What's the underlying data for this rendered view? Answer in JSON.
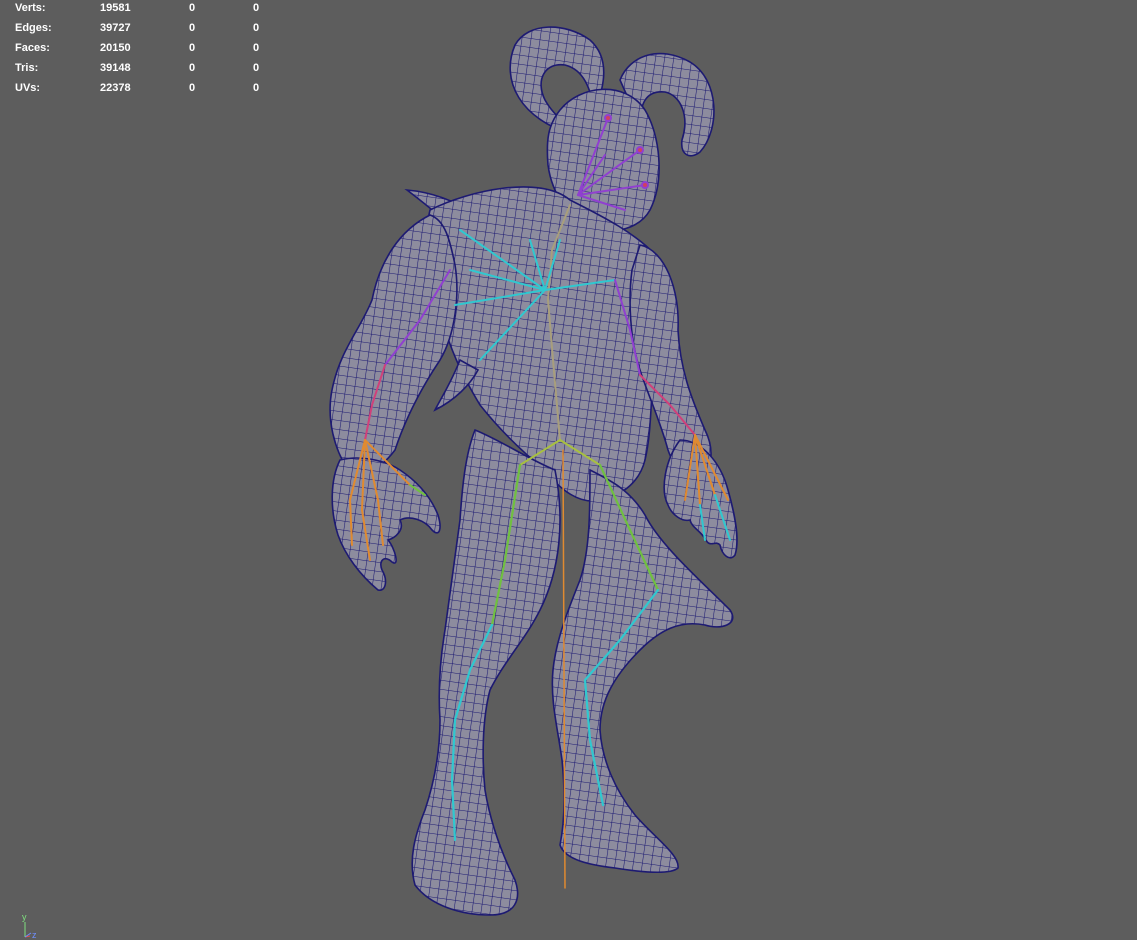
{
  "hud": {
    "rows": [
      {
        "label": "Verts:",
        "total": "19581",
        "selected": "0",
        "extra": "0"
      },
      {
        "label": "Edges:",
        "total": "39727",
        "selected": "0",
        "extra": "0"
      },
      {
        "label": "Faces:",
        "total": "20150",
        "selected": "0",
        "extra": "0"
      },
      {
        "label": "Tris:",
        "total": "39148",
        "selected": "0",
        "extra": "0"
      },
      {
        "label": "UVs:",
        "total": "22378",
        "selected": "0",
        "extra": "0"
      }
    ]
  },
  "axis": {
    "y_label": "y",
    "z_label": "z"
  },
  "colors": {
    "background": "#5d5d5d",
    "mesh_fill": "#8d8c9e",
    "wireframe": "#1d1a72",
    "joint_pink": "#d0407a",
    "joint_purple": "#9040d0",
    "joint_cyan": "#30c8d0",
    "joint_orange": "#e08a30",
    "joint_green": "#70c040"
  },
  "icons": {
    "model": "creature-mesh-icon",
    "skeleton": "skeleton-joints-icon",
    "axis": "axis-gizmo-icon"
  }
}
